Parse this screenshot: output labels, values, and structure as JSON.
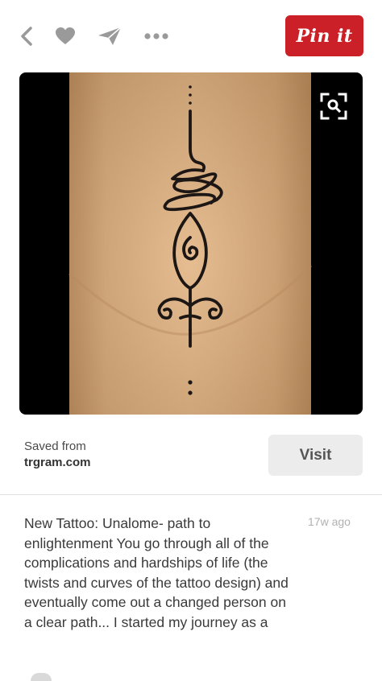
{
  "toolbar": {
    "icons": [
      "back-icon",
      "heart-icon",
      "send-icon",
      "more-icon"
    ],
    "pin_label": "Pin it",
    "icon_color": "#9a9a9a",
    "pin_color": "#cb2027"
  },
  "pin": {
    "image": {
      "description_icon": "visual-search-icon"
    },
    "source": {
      "label": "Saved from",
      "domain": "trgram.com"
    },
    "visit_label": "Visit",
    "description": "New Tattoo: Unalome- path to enlightenment You go through all of the complications and hardships of life (the twists and curves of the tattoo design) and eventually come out a changed person on a clear path... I started my journey as a",
    "time_ago": "17w ago"
  }
}
